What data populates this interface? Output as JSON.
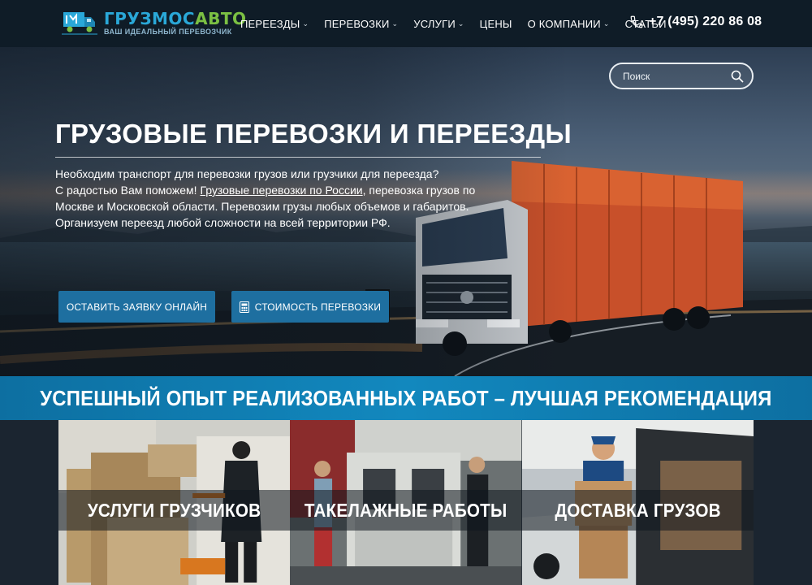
{
  "header": {
    "logo_title_a": "ГРУЗМОС",
    "logo_title_b": "АВТО",
    "logo_subtitle": "ВАШ ИДЕАЛЬНЫЙ ПЕРЕВОЗЧИК",
    "nav": [
      {
        "label": "ПЕРЕЕЗДЫ",
        "has_dropdown": true
      },
      {
        "label": "ПЕРЕВОЗКИ",
        "has_dropdown": true
      },
      {
        "label": "УСЛУГИ",
        "has_dropdown": true
      },
      {
        "label": "ЦЕНЫ",
        "has_dropdown": false
      },
      {
        "label": "О КОМПАНИИ",
        "has_dropdown": true
      },
      {
        "label": "СТАТЬИ",
        "has_dropdown": false
      }
    ],
    "phone": "+7 (495) 220 86 08",
    "chevron_glyph": "⌄"
  },
  "search": {
    "placeholder": "Поиск"
  },
  "hero": {
    "title": "ГРУЗОВЫЕ ПЕРЕВОЗКИ И ПЕРЕЕЗДЫ",
    "line1": "Необходим транспорт для перевозки грузов или грузчики для переезда?",
    "line2_pre": "С радостью Вам поможем! ",
    "line2_link": "Грузовые перевозки по России",
    "line2_post": ", перевозка грузов по Москве и Московской области. Перевозим грузы любых объемов и габаритов. Организуем переезд любой сложности на всей территории РФ.",
    "btn_order": "ОСТАВИТЬ ЗАЯВКУ ОНЛАЙН",
    "btn_cost": "СТОИМОСТЬ ПЕРЕВОЗКИ"
  },
  "banner": {
    "title": "УСПЕШНЫЙ ОПЫТ РЕАЛИЗОВАННЫХ РАБОТ – ЛУЧШАЯ РЕКОМЕНДАЦИЯ"
  },
  "services": [
    {
      "label": "УСЛУГИ ГРУЗЧИКОВ"
    },
    {
      "label": "ТАКЕЛАЖНЫЕ РАБОТЫ"
    },
    {
      "label": "ДОСТАВКА ГРУЗОВ"
    }
  ],
  "colors": {
    "header_bg": "#0f1c27",
    "accent_blue": "#1e6fa0",
    "banner_blue": "#1288be",
    "logo_blue": "#2aa8d8",
    "logo_green": "#7bc043"
  }
}
